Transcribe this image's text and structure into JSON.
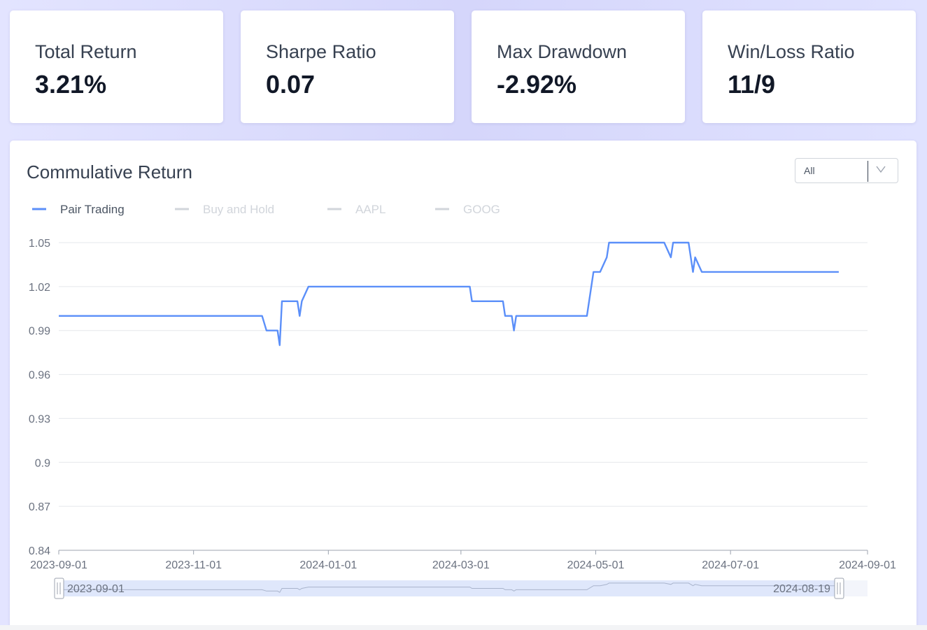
{
  "metrics": [
    {
      "label": "Total Return",
      "value": "3.21%"
    },
    {
      "label": "Sharpe Ratio",
      "value": "0.07"
    },
    {
      "label": "Max Drawdown",
      "value": "-2.92%"
    },
    {
      "label": "Win/Loss Ratio",
      "value": "11/9"
    }
  ],
  "chart_card": {
    "title": "Commulative Return",
    "select": {
      "value": "All"
    }
  },
  "colors": {
    "pair_trading": "#5b8ff9",
    "legend_inactive": "#d1d5db",
    "grid": "#e5e7eb",
    "zoom_fill": "#dfe7fb"
  },
  "chart_data": {
    "type": "line",
    "title": "Commulative Return",
    "xlabel": "",
    "ylabel": "",
    "legend": [
      {
        "name": "Pair Trading",
        "active": true
      },
      {
        "name": "Buy and Hold",
        "active": false
      },
      {
        "name": "AAPL",
        "active": false
      },
      {
        "name": "GOOG",
        "active": false
      }
    ],
    "y_ticks": [
      0.84,
      0.87,
      0.9,
      0.93,
      0.96,
      0.99,
      1.02,
      1.05
    ],
    "y_tick_labels": [
      "0.84",
      "0.87",
      "0.9",
      "0.93",
      "0.96",
      "0.99",
      "1.02",
      "1.05"
    ],
    "ylim": [
      0.84,
      1.05
    ],
    "x_ticks": [
      "2023-09-01",
      "2023-11-01",
      "2024-01-01",
      "2024-03-01",
      "2024-05-01",
      "2024-07-01",
      "2024-09-01"
    ],
    "xlim": [
      "2023-09-01",
      "2024-09-01"
    ],
    "grid": true,
    "zoom_range": {
      "start_label": "2023-09-01",
      "end_label": "2024-08-19"
    },
    "series": [
      {
        "name": "Pair Trading",
        "points": [
          {
            "x": "2023-09-01",
            "y": 1.0
          },
          {
            "x": "2023-12-02",
            "y": 1.0
          },
          {
            "x": "2023-12-04",
            "y": 0.99
          },
          {
            "x": "2023-12-06",
            "y": 0.99
          },
          {
            "x": "2023-12-09",
            "y": 0.99
          },
          {
            "x": "2023-12-10",
            "y": 0.98
          },
          {
            "x": "2023-12-11",
            "y": 1.01
          },
          {
            "x": "2023-12-18",
            "y": 1.01
          },
          {
            "x": "2023-12-19",
            "y": 1.0
          },
          {
            "x": "2023-12-20",
            "y": 1.01
          },
          {
            "x": "2023-12-23",
            "y": 1.02
          },
          {
            "x": "2024-03-05",
            "y": 1.02
          },
          {
            "x": "2024-03-06",
            "y": 1.01
          },
          {
            "x": "2024-03-20",
            "y": 1.01
          },
          {
            "x": "2024-03-21",
            "y": 1.0
          },
          {
            "x": "2024-03-24",
            "y": 1.0
          },
          {
            "x": "2024-03-25",
            "y": 0.99
          },
          {
            "x": "2024-03-26",
            "y": 1.0
          },
          {
            "x": "2024-04-27",
            "y": 1.0
          },
          {
            "x": "2024-04-30",
            "y": 1.03
          },
          {
            "x": "2024-05-03",
            "y": 1.03
          },
          {
            "x": "2024-05-06",
            "y": 1.04
          },
          {
            "x": "2024-05-07",
            "y": 1.05
          },
          {
            "x": "2024-05-27",
            "y": 1.05
          },
          {
            "x": "2024-06-01",
            "y": 1.05
          },
          {
            "x": "2024-06-04",
            "y": 1.04
          },
          {
            "x": "2024-06-05",
            "y": 1.05
          },
          {
            "x": "2024-06-12",
            "y": 1.05
          },
          {
            "x": "2024-06-14",
            "y": 1.03
          },
          {
            "x": "2024-06-15",
            "y": 1.04
          },
          {
            "x": "2024-06-18",
            "y": 1.03
          },
          {
            "x": "2024-08-19",
            "y": 1.03
          }
        ]
      }
    ]
  }
}
